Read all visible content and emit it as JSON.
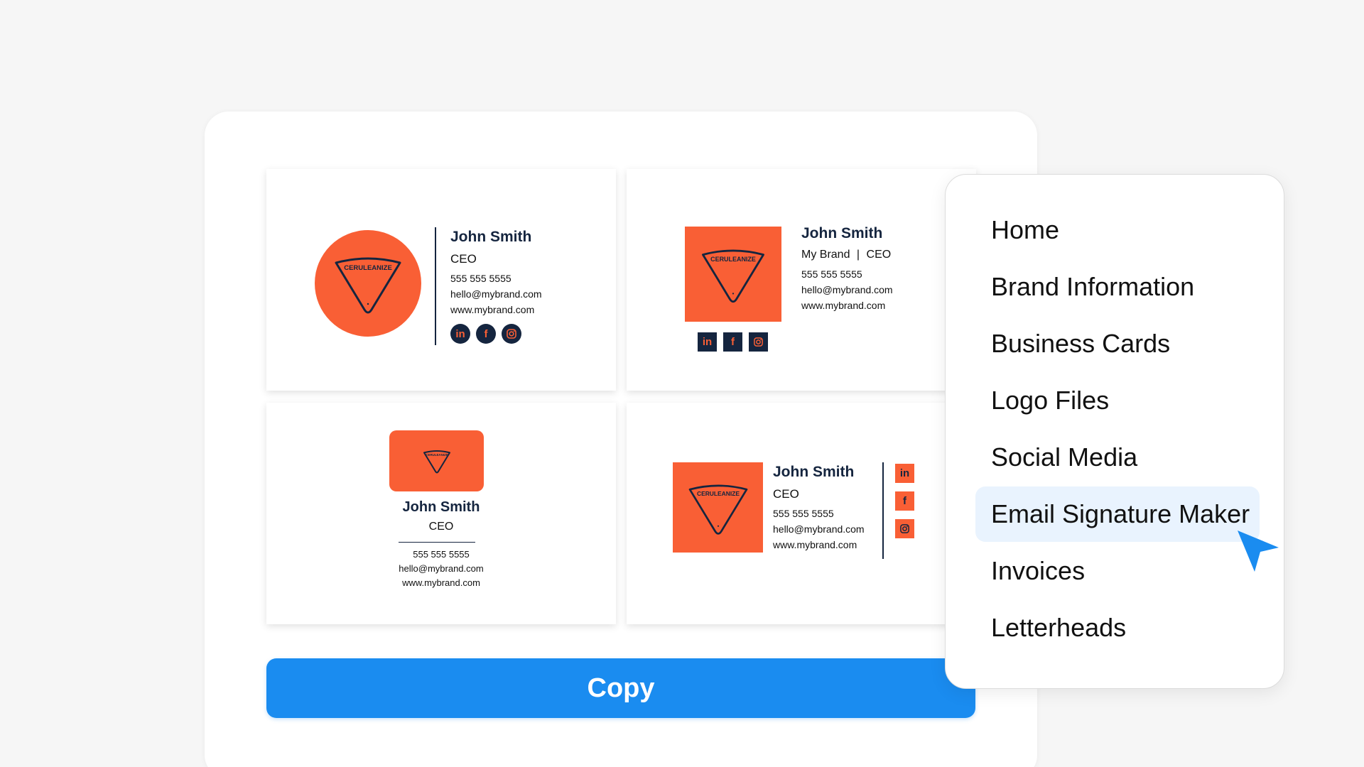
{
  "brand_logo_text": "CERULEANIZE",
  "colors": {
    "accent": "#f95f35",
    "navy": "#15253f",
    "primary_button": "#1a8cf0",
    "active_menu_bg": "#e9f3fe"
  },
  "cards": [
    {
      "name": "John Smith",
      "title": "CEO",
      "phone": "555 555 5555",
      "email": "hello@mybrand.com",
      "website": "www.mybrand.com",
      "socials": [
        "linkedin-icon",
        "facebook-icon",
        "instagram-icon"
      ]
    },
    {
      "name": "John Smith",
      "company": "My Brand",
      "separator": "|",
      "title": "CEO",
      "phone": "555 555 5555",
      "email": "hello@mybrand.com",
      "website": "www.mybrand.com",
      "socials": [
        "linkedin-icon",
        "facebook-icon",
        "instagram-icon"
      ]
    },
    {
      "name": "John Smith",
      "title": "CEO",
      "phone": "555 555 5555",
      "email": "hello@mybrand.com",
      "website": "www.mybrand.com"
    },
    {
      "name": "John Smith",
      "title": "CEO",
      "phone": "555 555 5555",
      "email": "hello@mybrand.com",
      "website": "www.mybrand.com",
      "socials": [
        "linkedin-icon",
        "facebook-icon",
        "instagram-icon"
      ]
    }
  ],
  "copy_button": {
    "label": "Copy"
  },
  "menu": {
    "items": [
      {
        "label": "Home"
      },
      {
        "label": "Brand Information"
      },
      {
        "label": "Business Cards"
      },
      {
        "label": "Logo Files"
      },
      {
        "label": "Social Media"
      },
      {
        "label": "Email Signature Maker",
        "active": true
      },
      {
        "label": "Invoices"
      },
      {
        "label": "Letterheads"
      }
    ]
  }
}
